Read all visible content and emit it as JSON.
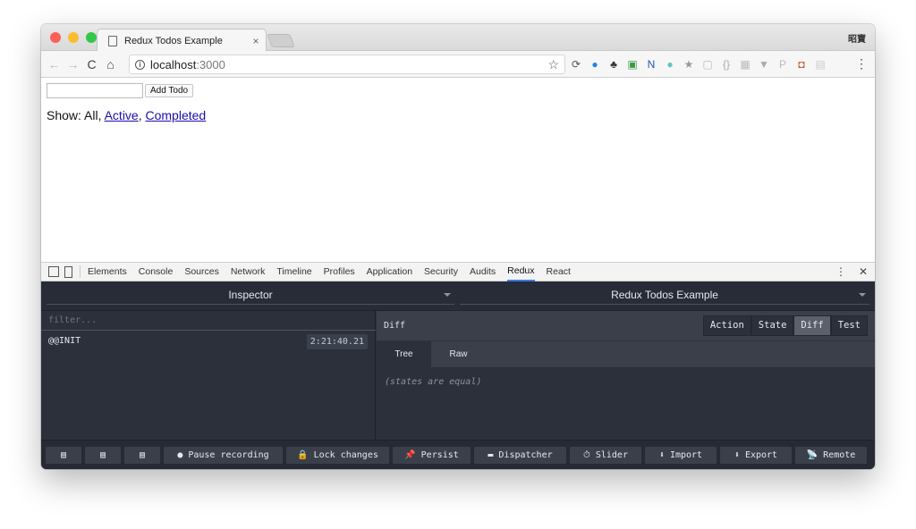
{
  "browser": {
    "tab_title": "Redux Todos Example",
    "tab_close": "×",
    "ime_label": "昭寶",
    "url_host": "localhost",
    "url_port": ":3000",
    "nav": {
      "back": "←",
      "forward": "→",
      "reload": "C",
      "home": "⌂"
    },
    "star": "☆",
    "menu": "⋮",
    "traffic_lights": [
      "#fc5f57",
      "#fdbc2e",
      "#33c748"
    ],
    "extensions": [
      {
        "name": "sync-icon",
        "glyph": "⟳",
        "color": "#555555"
      },
      {
        "name": "blue-circle-ext-icon",
        "glyph": "●",
        "color": "#1e88e5"
      },
      {
        "name": "evernote-icon",
        "glyph": "♣",
        "color": "#333333"
      },
      {
        "name": "green-ext-icon",
        "glyph": "▣",
        "color": "#3c9a46"
      },
      {
        "name": "notion-icon",
        "glyph": "N",
        "color": "#2255bb"
      },
      {
        "name": "colorful-ext-icon",
        "glyph": "●",
        "color": "#58c8c2"
      },
      {
        "name": "bookmark-ext-icon",
        "glyph": "★",
        "color": "#999999"
      },
      {
        "name": "gray-ext-icon",
        "glyph": "▢",
        "color": "#bbbbbb"
      },
      {
        "name": "json-icon",
        "glyph": "{}",
        "color": "#aaaaaa"
      },
      {
        "name": "grid-ext-icon",
        "glyph": "▦",
        "color": "#bbbbbb"
      },
      {
        "name": "shield-icon",
        "glyph": "▼",
        "color": "#aaaaaa"
      },
      {
        "name": "p-ext-icon",
        "glyph": "P",
        "color": "#bbbbbb"
      },
      {
        "name": "instagram-icon",
        "glyph": "◘",
        "color": "#c0552c"
      },
      {
        "name": "light-ext-icon",
        "glyph": "▤",
        "color": "#cccccc"
      }
    ]
  },
  "page": {
    "add_button": "Add Todo",
    "show_label": "Show: All, ",
    "filter_active": "Active",
    "filter_sep": ", ",
    "filter_completed": "Completed"
  },
  "devtools": {
    "tabs": [
      "Elements",
      "Console",
      "Sources",
      "Network",
      "Timeline",
      "Profiles",
      "Application",
      "Security",
      "Audits",
      "Redux",
      "React"
    ],
    "active_tab": "Redux",
    "more": "⋮",
    "close": "✕"
  },
  "redux": {
    "monitor_select": "Inspector",
    "instance_select": "Redux Todos Example",
    "filter_placeholder": "filter...",
    "action_name": "@@INIT",
    "action_time": "2:21:40.21",
    "panel_title": "Diff",
    "view_tabs": [
      "Action",
      "State",
      "Diff",
      "Test"
    ],
    "active_view": "Diff",
    "sub_tabs": [
      "Tree",
      "Raw"
    ],
    "active_sub": "Tree",
    "diff_message": "(states are equal)",
    "bottom_buttons": [
      {
        "name": "layout-left-button",
        "label": "▤",
        "w": 40
      },
      {
        "name": "layout-bottom-button",
        "label": "▤",
        "w": 40
      },
      {
        "name": "layout-right-button",
        "label": "▤",
        "w": 40
      },
      {
        "name": "pause-recording-button",
        "label": "● Pause recording",
        "w": 133
      },
      {
        "name": "lock-changes-button",
        "label": "🔒 Lock changes",
        "w": 115
      },
      {
        "name": "persist-button",
        "label": "📌 Persist",
        "w": 87
      },
      {
        "name": "dispatcher-button",
        "label": "▬ Dispatcher",
        "w": 103
      },
      {
        "name": "slider-button",
        "label": "⏱ Slider",
        "w": 80
      },
      {
        "name": "import-button",
        "label": "⬇ Import",
        "w": 80
      },
      {
        "name": "export-button",
        "label": "⬇ Export",
        "w": 80
      },
      {
        "name": "remote-button",
        "label": "📡 Remote",
        "w": 80
      }
    ]
  }
}
